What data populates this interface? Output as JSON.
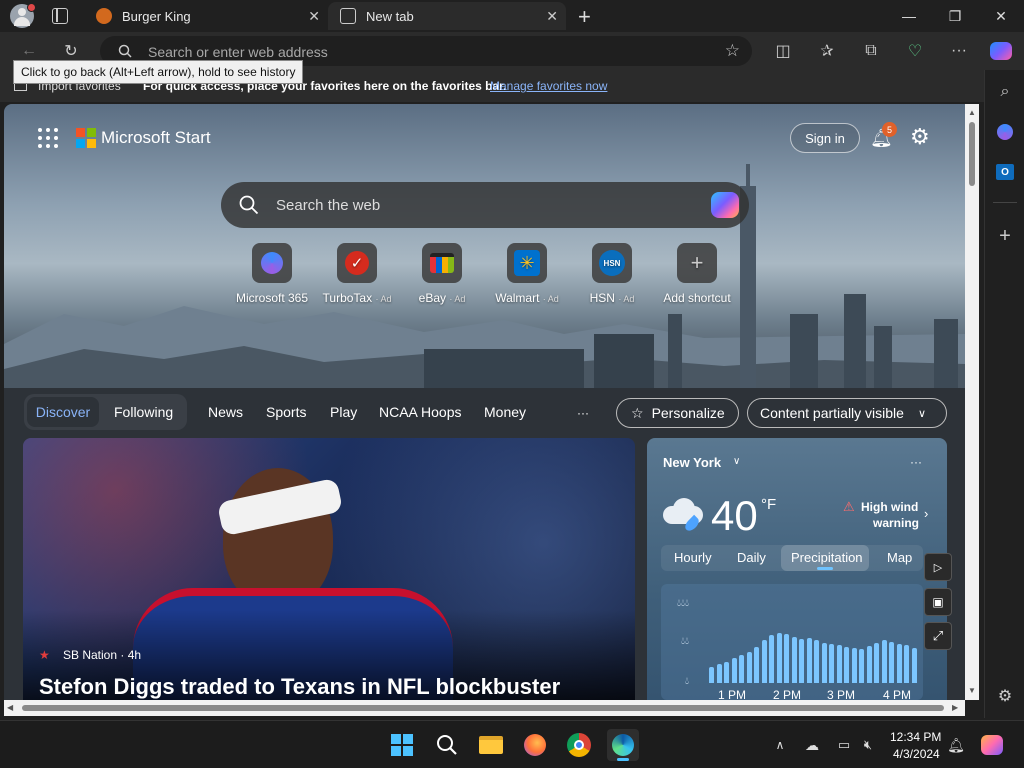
{
  "tabs": [
    {
      "label": "Burger King"
    },
    {
      "label": "New tab"
    }
  ],
  "address": {
    "placeholder": "Search or enter web address"
  },
  "tooltip": "Click to go back (Alt+Left arrow), hold to see history",
  "favorites_bar": {
    "import_label": "Import favorites",
    "message": "For quick access, place your favorites here on the favorites bar.",
    "manage_link": "Manage favorites now"
  },
  "header": {
    "brand": "Microsoft Start",
    "sign_in": "Sign in",
    "notif_count": "5"
  },
  "search": {
    "placeholder": "Search the web"
  },
  "shortcuts": [
    {
      "label": "Microsoft 365",
      "ad": ""
    },
    {
      "label": "TurboTax",
      "ad": "· Ad"
    },
    {
      "label": "eBay",
      "ad": "· Ad"
    },
    {
      "label": "Walmart",
      "ad": "· Ad"
    },
    {
      "label": "HSN",
      "ad": "· Ad",
      "icon_text": "HSN"
    },
    {
      "label": "Add shortcut",
      "ad": ""
    }
  ],
  "feed_tabs": {
    "discover": "Discover",
    "following": "Following",
    "items": [
      "News",
      "Sports",
      "Play",
      "NCAA Hoops",
      "Money"
    ],
    "more": "···",
    "personalize": "Personalize",
    "content": "Content partially visible"
  },
  "story": {
    "source": "SB Nation · 4h",
    "headline": "Stefon Diggs traded to Texans in NFL blockbuster"
  },
  "weather": {
    "city": "New York",
    "temp": "40",
    "unit": "°F",
    "alert_line1": "High wind",
    "alert_line2": "warning",
    "tabs": [
      "Hourly",
      "Daily",
      "Precipitation",
      "Map"
    ],
    "time_labels": [
      "1 PM",
      "2 PM",
      "3 PM",
      "4 PM"
    ],
    "bar_levels": [
      0.32,
      0.38,
      0.42,
      0.5,
      0.55,
      0.62,
      0.72,
      0.85,
      0.95,
      1.0,
      0.97,
      0.92,
      0.88,
      0.9,
      0.85,
      0.8,
      0.78,
      0.75,
      0.72,
      0.7,
      0.68,
      0.74,
      0.8,
      0.85,
      0.82,
      0.78,
      0.75,
      0.7
    ],
    "more": "···"
  },
  "taskbar": {
    "time": "12:34 PM",
    "date": "4/3/2024"
  }
}
